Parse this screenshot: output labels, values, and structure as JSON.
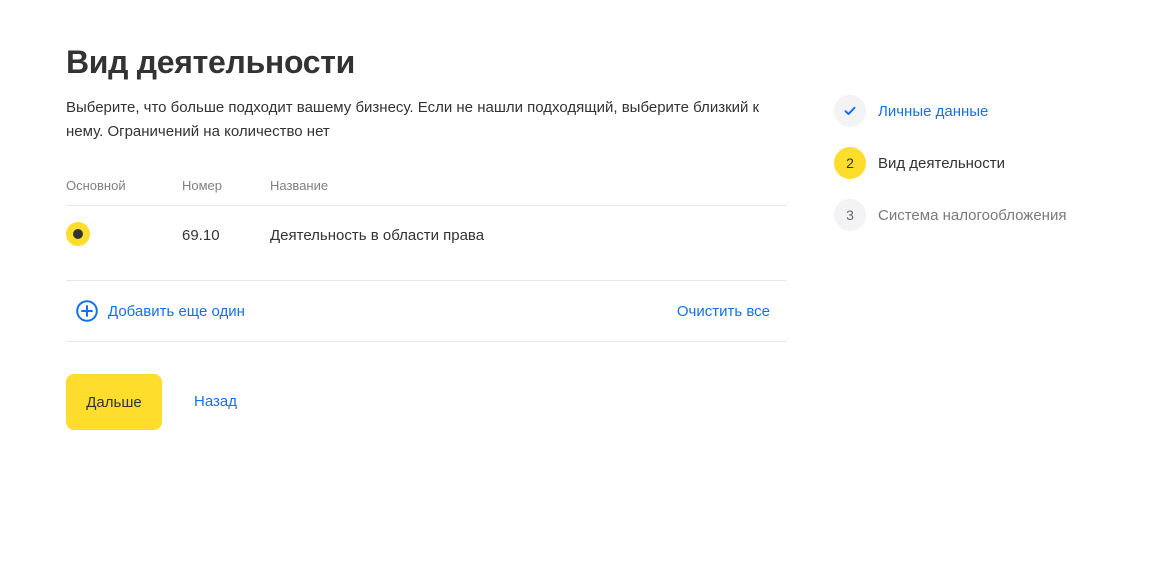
{
  "page": {
    "title": "Вид деятельности",
    "subtitle": "Выберите, что больше подходит вашему бизнесу. Если не нашли подходящий, выберите близкий к нему. Ограничений на количество нет"
  },
  "table": {
    "headers": {
      "primary": "Основной",
      "number": "Номер",
      "name": "Название"
    },
    "rows": [
      {
        "primary_selected": true,
        "number": "69.10",
        "name": "Деятельность в области права"
      }
    ]
  },
  "actions": {
    "add_label": "Добавить еще один",
    "clear_label": "Очистить все"
  },
  "buttons": {
    "next_label": "Дальше",
    "back_label": "Назад"
  },
  "steps": [
    {
      "marker": "✓",
      "label": "Личные данные",
      "state": "done"
    },
    {
      "marker": "2",
      "label": "Вид деятельности",
      "state": "active"
    },
    {
      "marker": "3",
      "label": "Система налогообложения",
      "state": "pending"
    }
  ],
  "colors": {
    "accent_yellow": "#ffdd2d",
    "link_blue": "#1771e6",
    "text_dark": "#333333",
    "text_muted": "#808080"
  },
  "icons": {
    "add": "plus-circle-icon",
    "step_done": "check-icon"
  }
}
